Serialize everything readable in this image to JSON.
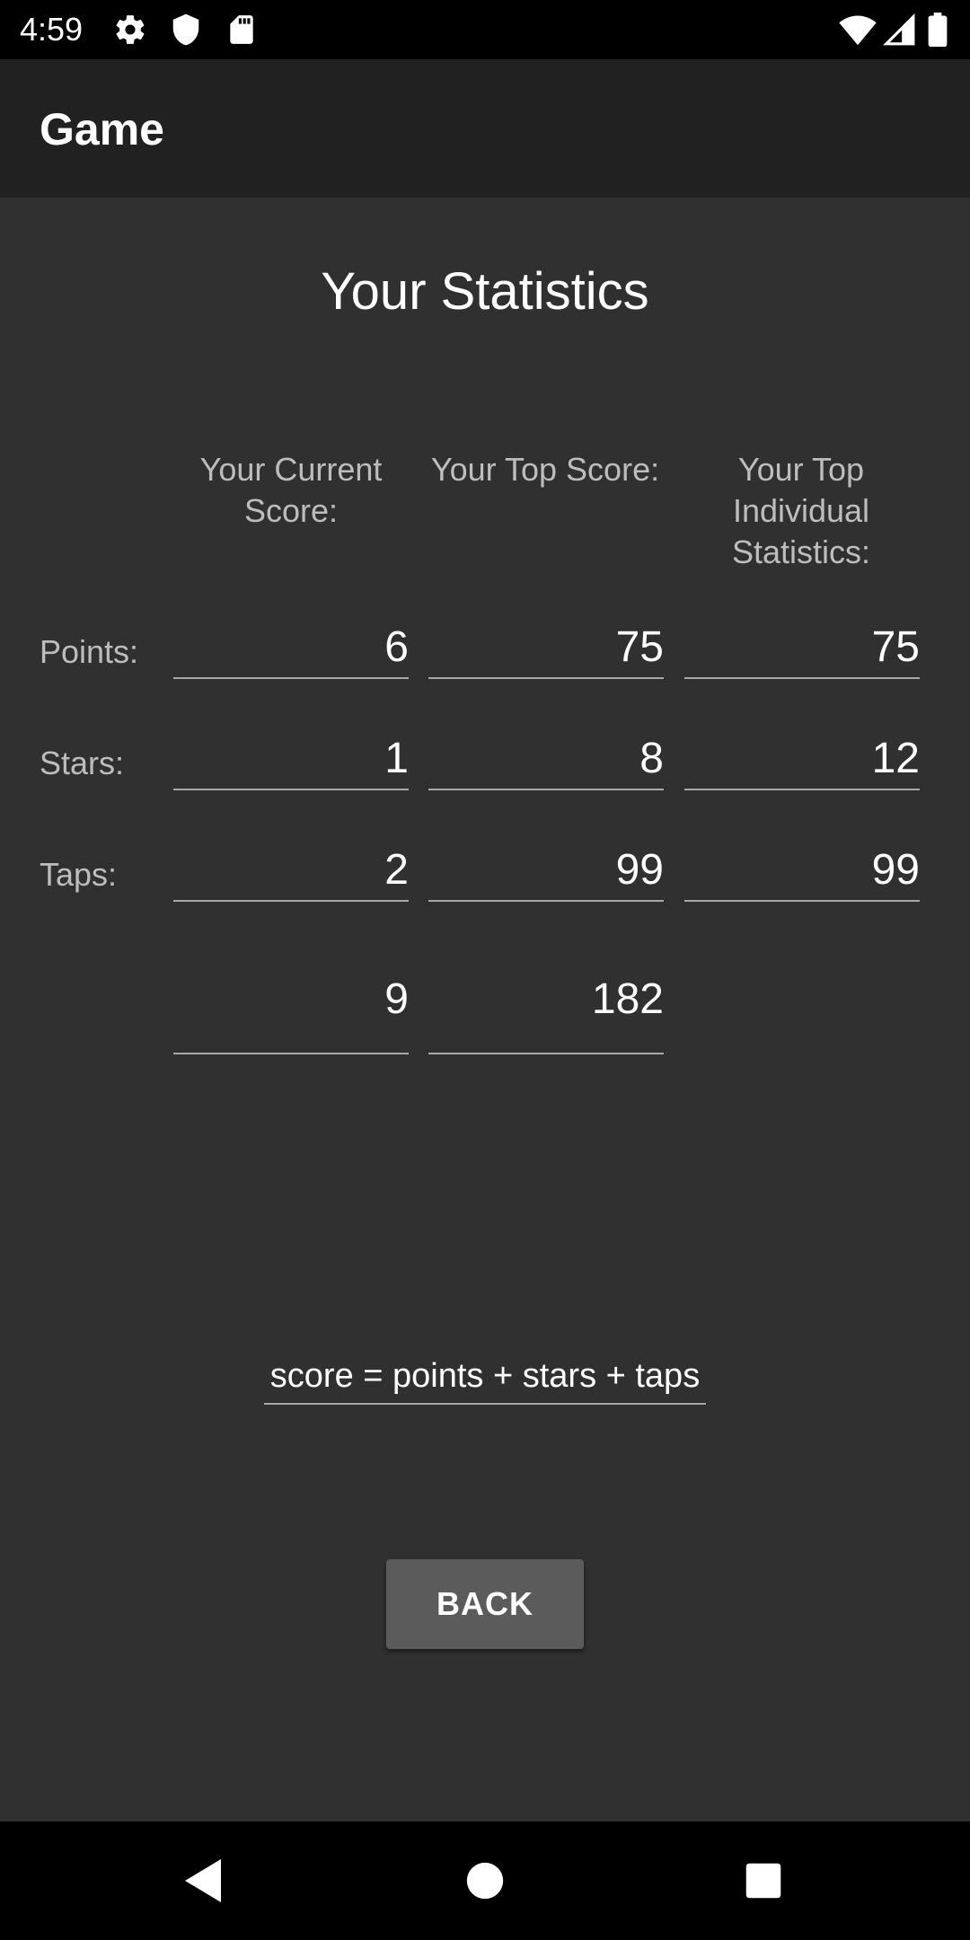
{
  "status_bar": {
    "time": "4:59",
    "icons": [
      "gear-icon",
      "shield-icon",
      "sd-card-icon",
      "wifi-icon",
      "signal-icon",
      "battery-icon"
    ]
  },
  "app_bar": {
    "title": "Game"
  },
  "page": {
    "title": "Your Statistics",
    "columns": [
      "Your Current Score:",
      "Your Top Score:",
      "Your Top Individual Statistics:"
    ],
    "rows": [
      {
        "label": "Points:",
        "current": "6",
        "top": "75",
        "individual": "75"
      },
      {
        "label": "Stars:",
        "current": "1",
        "top": "8",
        "individual": "12"
      },
      {
        "label": "Taps:",
        "current": "2",
        "top": "99",
        "individual": "99"
      }
    ],
    "totals": {
      "current": "9",
      "top": "182"
    },
    "formula": "score = points + stars + taps",
    "back_label": "BACK"
  },
  "nav_bar": {
    "icons": [
      "back-icon",
      "home-icon",
      "recents-icon"
    ]
  },
  "colors": {
    "background": "#303030",
    "app_bar": "#212121",
    "button": "#5b5b5b",
    "label": "#bdbdbd",
    "underline": "#a8a8a8"
  }
}
